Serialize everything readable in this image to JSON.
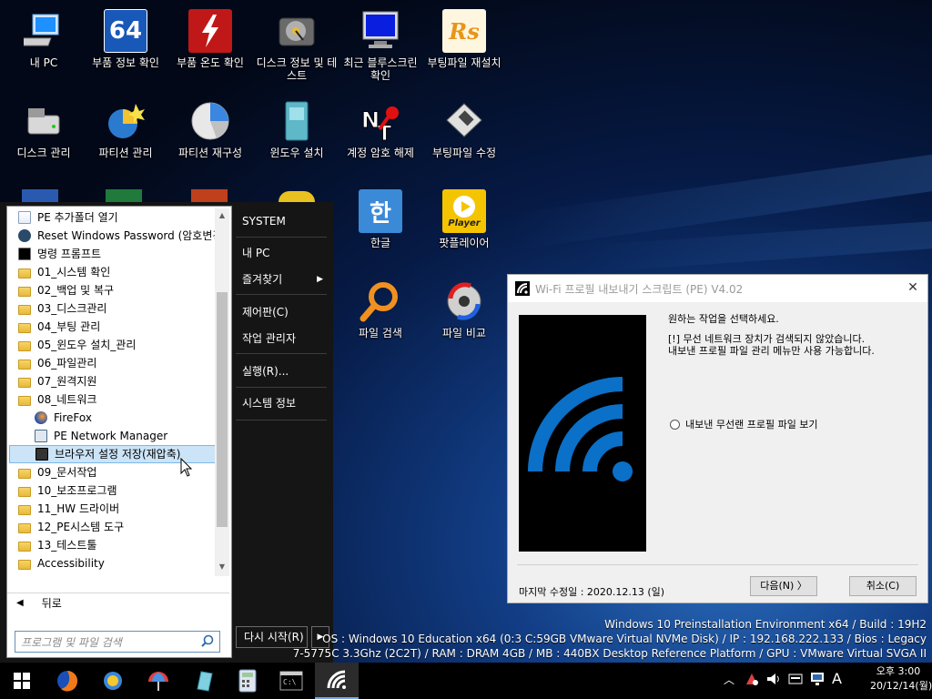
{
  "desktop": {
    "row1": [
      {
        "label": "내 PC",
        "icon": "my-pc-icon"
      },
      {
        "label": "부품 정보 확인",
        "icon": "cpu-64-icon"
      },
      {
        "label": "부품 온도 확인",
        "icon": "temperature-icon"
      },
      {
        "label": "디스크 정보 및 테스트",
        "icon": "hard-disk-icon"
      },
      {
        "label": "최근 블루스크린 확인",
        "icon": "bluescreen-monitor-icon"
      },
      {
        "label": "부팅파일 재설치",
        "icon": "rs-boot-icon"
      }
    ],
    "row2": [
      {
        "label": "디스크 관리",
        "icon": "disk-management-icon"
      },
      {
        "label": "파티션 관리",
        "icon": "partition-wizard-icon"
      },
      {
        "label": "파티션 재구성",
        "icon": "partition-pie-icon"
      },
      {
        "label": "윈도우 설치",
        "icon": "windows-install-icon"
      },
      {
        "label": "계정 암호 해제",
        "icon": "nt-password-icon"
      },
      {
        "label": "부팅파일 수정",
        "icon": "boot-fix-icon"
      }
    ],
    "row3": [
      {
        "label": "한글",
        "icon": "hangul-icon"
      },
      {
        "label": "팟플레이어",
        "icon": "potplayer-icon",
        "badge": "Player"
      }
    ],
    "row4": [
      {
        "label": "파일 검색",
        "icon": "file-search-icon"
      },
      {
        "label": "파일 비교",
        "icon": "file-compare-icon"
      }
    ],
    "cpu_badge": "64"
  },
  "startmenu": {
    "items": [
      {
        "label": "PE 추가폴더 열기",
        "icon": "folder-open-icon",
        "type": "app"
      },
      {
        "label": "Reset Windows Password (암호변경)",
        "icon": "lock-icon",
        "type": "app"
      },
      {
        "label": "명령 프롬프트",
        "icon": "cmd-icon",
        "type": "app"
      },
      {
        "label": "01_시스템 확인",
        "icon": "folder-icon",
        "type": "folder"
      },
      {
        "label": "02_백업 및 복구",
        "icon": "folder-icon",
        "type": "folder"
      },
      {
        "label": "03_디스크관리",
        "icon": "folder-icon",
        "type": "folder"
      },
      {
        "label": "04_부팅 관리",
        "icon": "folder-icon",
        "type": "folder"
      },
      {
        "label": "05_윈도우 설치_관리",
        "icon": "folder-icon",
        "type": "folder"
      },
      {
        "label": "06_파일관리",
        "icon": "folder-icon",
        "type": "folder"
      },
      {
        "label": "07_원격지원",
        "icon": "folder-icon",
        "type": "folder"
      },
      {
        "label": "08_네트워크",
        "icon": "folder-icon",
        "type": "folder"
      },
      {
        "label": "FireFox",
        "icon": "firefox-icon",
        "type": "sub"
      },
      {
        "label": "PE Network Manager",
        "icon": "network-manager-icon",
        "type": "sub"
      },
      {
        "label": "브라우저 설정 저장(재압축)",
        "icon": "save-icon",
        "type": "sub-selected"
      },
      {
        "label": "09_문서작업",
        "icon": "folder-icon",
        "type": "folder"
      },
      {
        "label": "10_보조프로그램",
        "icon": "folder-icon",
        "type": "folder"
      },
      {
        "label": "11_HW 드라이버",
        "icon": "folder-icon",
        "type": "folder"
      },
      {
        "label": "12_PE시스템 도구",
        "icon": "folder-icon",
        "type": "folder"
      },
      {
        "label": "13_테스트툴",
        "icon": "folder-icon",
        "type": "folder"
      },
      {
        "label": "Accessibility",
        "icon": "folder-icon",
        "type": "folder"
      }
    ],
    "back_label": "뒤로",
    "search_placeholder": "프로그램 및 파일 검색",
    "right": {
      "system": "SYSTEM",
      "my_pc": "내 PC",
      "favorites": "즐겨찾기",
      "control_panel": "제어판(C)",
      "task_manager": "작업 관리자",
      "run": "실행(R)...",
      "system_info": "시스템 정보"
    },
    "restart_label": "다시 시작(R)"
  },
  "dialog": {
    "title": "Wi-Fi 프로필 내보내기 스크립트 (PE) V4.02",
    "message": "원하는 작업을 선택하세요.",
    "warning_line1": "[!] 무선 네트워크 장치가 검색되지 않았습니다.",
    "warning_line2": "내보낸 프로필 파일 관리 메뉴만 사용 가능합니다.",
    "option_label": "내보낸 무선랜 프로필 파일 보기",
    "modified": "마지막 수정일 : 2020.12.13 (일)",
    "next_label": "다음(N) 〉",
    "cancel_label": "취소(C)",
    "accent": "#0a70c8"
  },
  "sysinfo": {
    "line1": "Windows 10 Preinstallation Environment x64 / Build : 19H2",
    "line2": "OS : Windows 10 Education x64 (0:3 C:59GB VMware Virtual NVMe Disk) / IP : 192.168.222.133 / Bios : Legacy",
    "line3": "7-5775C 3.3Ghz (2C2T) / RAM : DRAM 4GB / MB : 440BX Desktop Reference Platform / GPU : VMware Virtual SVGA II"
  },
  "taskbar": {
    "apps": [
      {
        "name": "start-button",
        "icon": "windows-logo-icon"
      },
      {
        "name": "firefox-taskbar",
        "icon": "firefox-icon"
      },
      {
        "name": "weather-taskbar",
        "icon": "sun-icon"
      },
      {
        "name": "umbrella-taskbar",
        "icon": "umbrella-icon"
      },
      {
        "name": "explorer-taskbar",
        "icon": "glass-icon"
      },
      {
        "name": "calculator-taskbar",
        "icon": "calculator-icon"
      },
      {
        "name": "cmd-taskbar",
        "icon": "cmd-icon"
      },
      {
        "name": "wifi-script-taskbar",
        "icon": "wifi-icon"
      }
    ],
    "ime": "A",
    "time": "오후 3:00",
    "date": "20/12/14(월)"
  }
}
